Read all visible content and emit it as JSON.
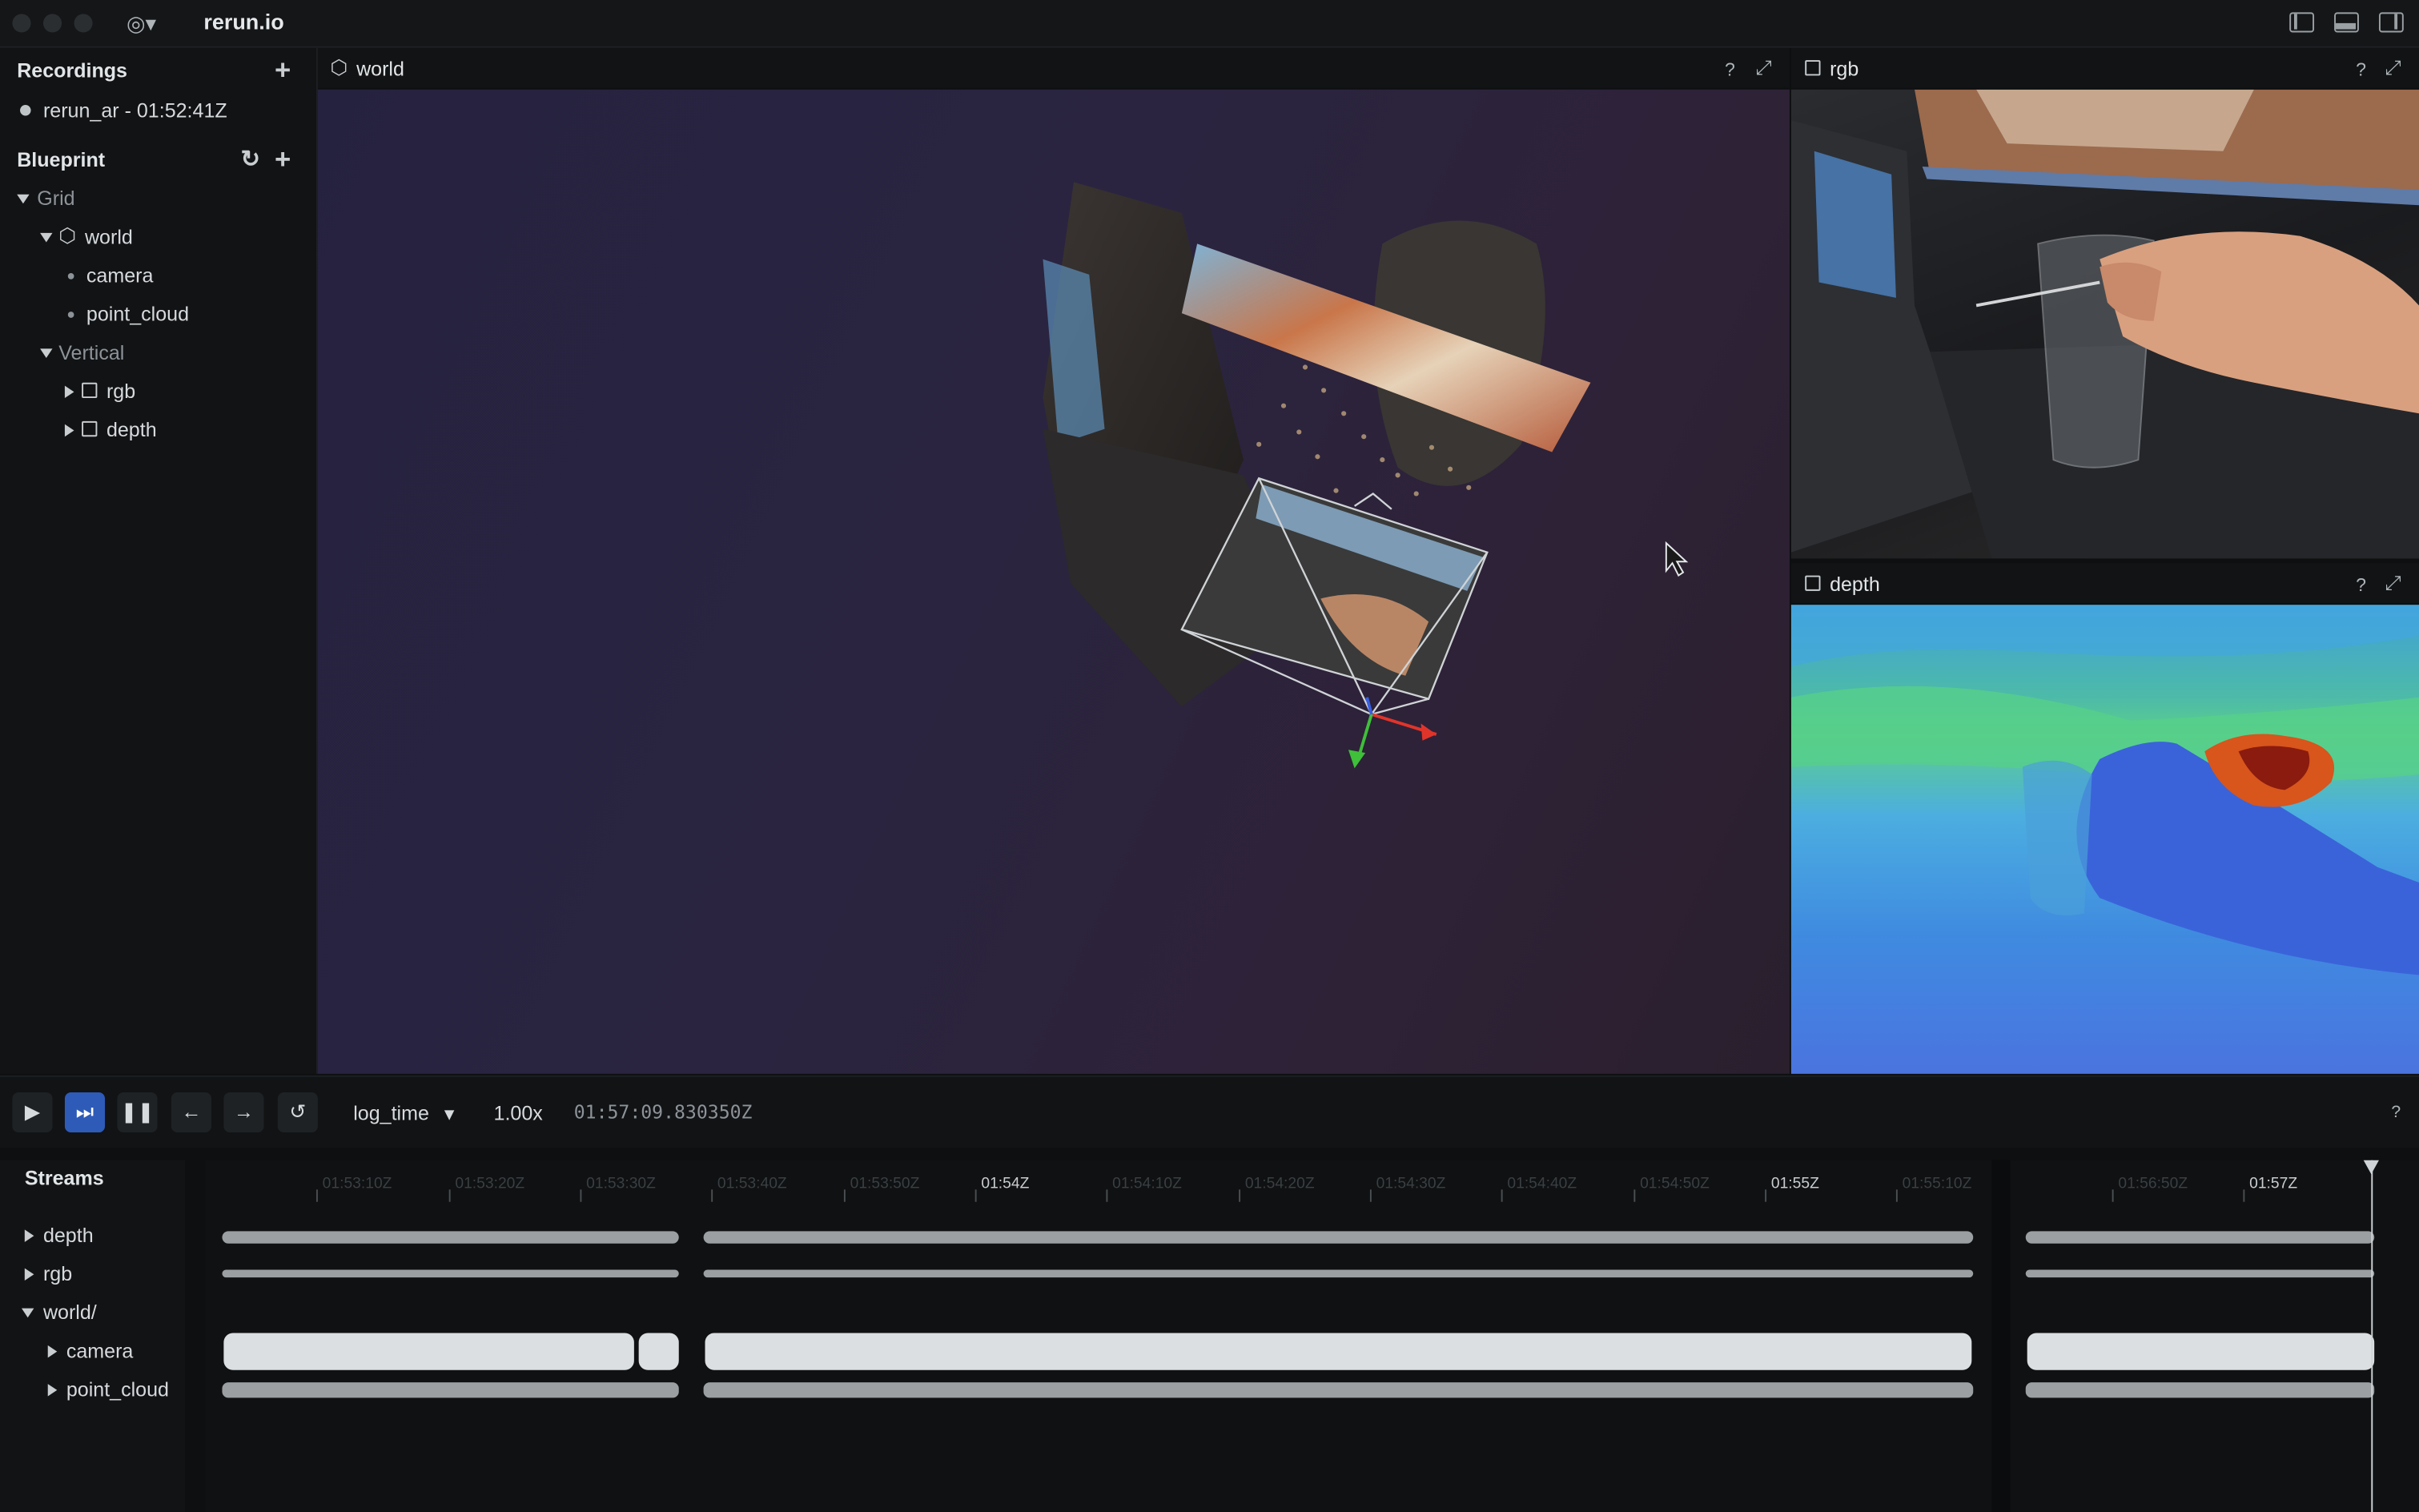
{
  "window": {
    "title": "rerun.io"
  },
  "recordings": {
    "title": "Recordings",
    "items": [
      {
        "label": "rerun_ar - 01:52:41Z"
      }
    ]
  },
  "blueprint": {
    "title": "Blueprint",
    "tree": {
      "grid": "Grid",
      "world": "world",
      "camera": "camera",
      "point_cloud": "point_cloud",
      "vertical": "Vertical",
      "rgb": "rgb",
      "depth": "depth"
    }
  },
  "views": {
    "world": {
      "title": "world",
      "help": "?"
    },
    "rgb": {
      "title": "rgb",
      "help": "?"
    },
    "depth": {
      "title": "depth",
      "help": "?"
    }
  },
  "timebar": {
    "timeline": "log_time",
    "speed": "1.00x",
    "current_time": "01:57:09.830350Z",
    "help": "?"
  },
  "streams": {
    "title": "Streams",
    "items": [
      "depth",
      "rgb",
      "world/",
      "camera",
      "point_cloud"
    ],
    "ticks": [
      {
        "label": "01:53:10Z",
        "major": false
      },
      {
        "label": "01:53:20Z",
        "major": false
      },
      {
        "label": "01:53:30Z",
        "major": false
      },
      {
        "label": "01:53:40Z",
        "major": false
      },
      {
        "label": "01:53:50Z",
        "major": false
      },
      {
        "label": "01:54Z",
        "major": true
      },
      {
        "label": "01:54:10Z",
        "major": false
      },
      {
        "label": "01:54:20Z",
        "major": false
      },
      {
        "label": "01:54:30Z",
        "major": false
      },
      {
        "label": "01:54:40Z",
        "major": false
      },
      {
        "label": "01:54:50Z",
        "major": false
      },
      {
        "label": "01:55Z",
        "major": true
      },
      {
        "label": "01:55:10Z",
        "major": false
      },
      {
        "label": "01:56:50Z",
        "major": false
      },
      {
        "label": "01:57Z",
        "major": true
      }
    ]
  },
  "colors": {
    "accent": "#2e5bb8",
    "background": "#0d0f10",
    "panel": "#111315",
    "axis_x": "#e0342b",
    "axis_y": "#3fbf3a",
    "axis_z": "#3a5fe0"
  }
}
